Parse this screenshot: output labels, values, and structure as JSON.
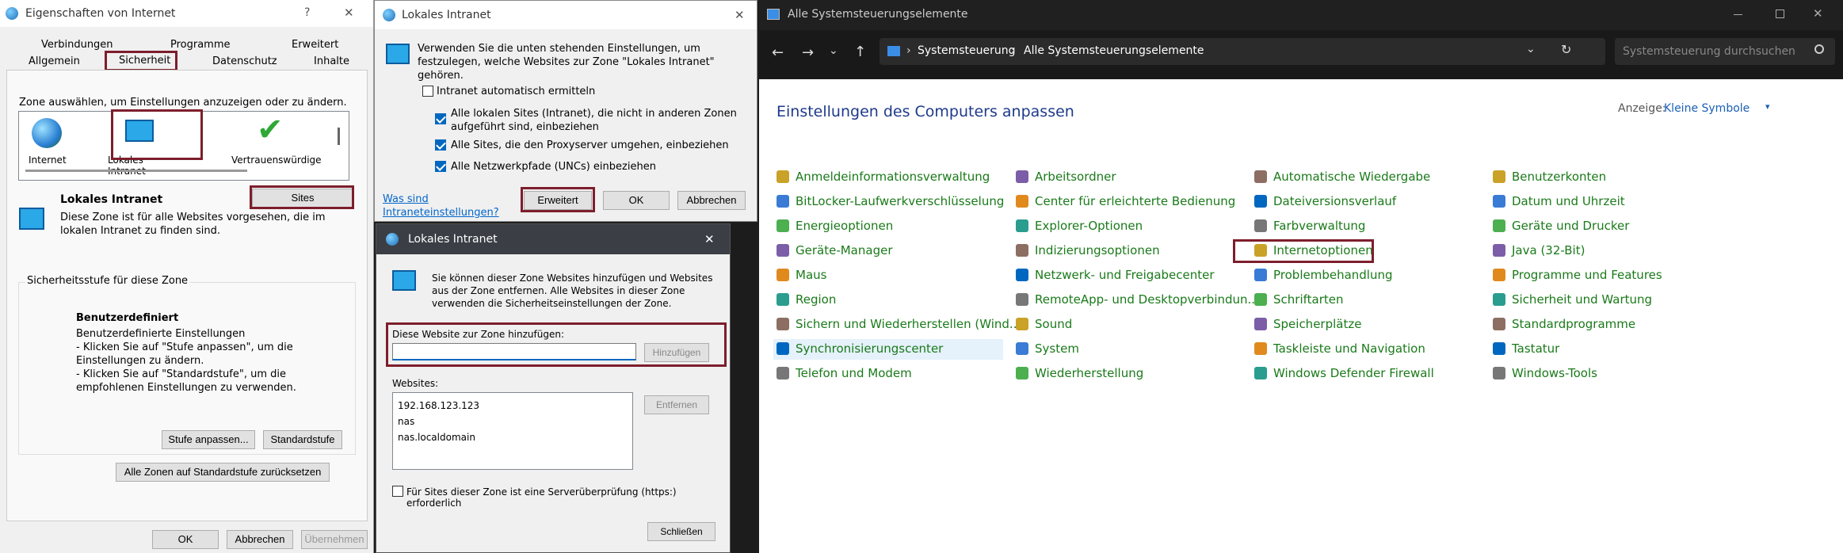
{
  "dlg1": {
    "title": "Eigenschaften von Internet",
    "help": "?",
    "close": "✕",
    "tabs": [
      "Verbindungen",
      "Programme",
      "Erweitert",
      "Allgemein",
      "Sicherheit",
      "Datenschutz",
      "Inhalte"
    ],
    "zone_prompt": "Zone auswählen, um Einstellungen anzuzeigen oder zu ändern.",
    "zones": [
      "Internet",
      "Lokales Intranet",
      "Vertrauenswürdige"
    ],
    "zone_title": "Lokales Intranet",
    "sites_btn": "Sites",
    "zone_desc": "Diese Zone ist für alle Websites vorgesehen, die im lokalen Intranet zu finden sind.",
    "level_group": "Sicherheitsstufe für diese Zone",
    "level_title": "Benutzerdefiniert",
    "level_lines": [
      "Benutzerdefinierte Einstellungen",
      "- Klicken Sie auf \"Stufe anpassen\", um die Einstellungen zu ändern.",
      "- Klicken Sie auf \"Standardstufe\", um die empfohlenen Einstellungen zu verwenden."
    ],
    "custom_btn": "Stufe anpassen...",
    "default_btn": "Standardstufe",
    "reset_btn": "Alle Zonen auf Standardstufe zurücksetzen",
    "ok": "OK",
    "cancel": "Abbrechen",
    "apply": "Übernehmen"
  },
  "dlg2": {
    "title": "Lokales Intranet",
    "close": "✕",
    "desc": "Verwenden Sie die unten stehenden Einstellungen, um festzulegen, welche Websites zur Zone \"Lokales Intranet\" gehören.",
    "auto": "Intranet automatisch ermitteln",
    "opt1": "Alle lokalen Sites (Intranet), die nicht in anderen Zonen aufgeführt sind, einbeziehen",
    "opt2": "Alle Sites, die den Proxyserver umgehen, einbeziehen",
    "opt3": "Alle Netzwerkpfade (UNCs) einbeziehen",
    "help_link": "Was sind Intraneteinstellungen?",
    "advanced": "Erweitert",
    "ok": "OK",
    "cancel": "Abbrechen"
  },
  "dlg3": {
    "title": "Lokales Intranet",
    "close": "✕",
    "desc": "Sie können dieser Zone Websites hinzufügen und Websites aus der Zone entfernen. Alle Websites in dieser Zone verwenden die Sicherheitseinstellungen der Zone.",
    "add_label": "Diese Website zur Zone hinzufügen:",
    "add_btn": "Hinzufügen",
    "sites_label": "Websites:",
    "sites": [
      "192.168.123.123",
      "nas",
      "nas.localdomain"
    ],
    "remove_btn": "Entfernen",
    "https": "Für Sites dieser Zone ist eine Serverüberprüfung (https:) erforderlich",
    "close_btn": "Schließen"
  },
  "cp": {
    "title": "Alle Systemsteuerungselemente",
    "bc1": "Systemsteuerung",
    "bc2": "Alle Systemsteuerungselemente",
    "search_ph": "Systemsteuerung durchsuchen",
    "heading": "Einstellungen des Computers anpassen",
    "view_label": "Anzeige:",
    "view_value": "Kleine Symbole",
    "cols": [
      [
        "Anmeldeinformationsverwaltung",
        "BitLocker-Laufwerkverschlüsselung",
        "Energieoptionen",
        "Geräte-Manager",
        "Maus",
        "Region",
        "Sichern und Wiederherstellen (Wind...",
        "Synchronisierungscenter",
        "Telefon und Modem"
      ],
      [
        "Arbeitsordner",
        "Center für erleichterte Bedienung",
        "Explorer-Optionen",
        "Indizierungsoptionen",
        "Netzwerk- und Freigabecenter",
        "RemoteApp- und Desktopverbindun...",
        "Sound",
        "System",
        "Wiederherstellung"
      ],
      [
        "Automatische Wiedergabe",
        "Dateiversionsverlauf",
        "Farbverwaltung",
        "Internetoptionen",
        "Problembehandlung",
        "Schriftarten",
        "Speicherplätze",
        "Taskleiste und Navigation",
        "Windows Defender Firewall"
      ],
      [
        "Benutzerkonten",
        "Datum und Uhrzeit",
        "Geräte und Drucker",
        "Java (32-Bit)",
        "Programme und Features",
        "Sicherheit und Wartung",
        "Standardprogramme",
        "Tastatur",
        "Windows-Tools"
      ]
    ],
    "colors": {
      "link": "#1a7a1a",
      "heading": "#1e3a8a",
      "accent": "#0067c0",
      "red": "#7d1e2c"
    }
  }
}
